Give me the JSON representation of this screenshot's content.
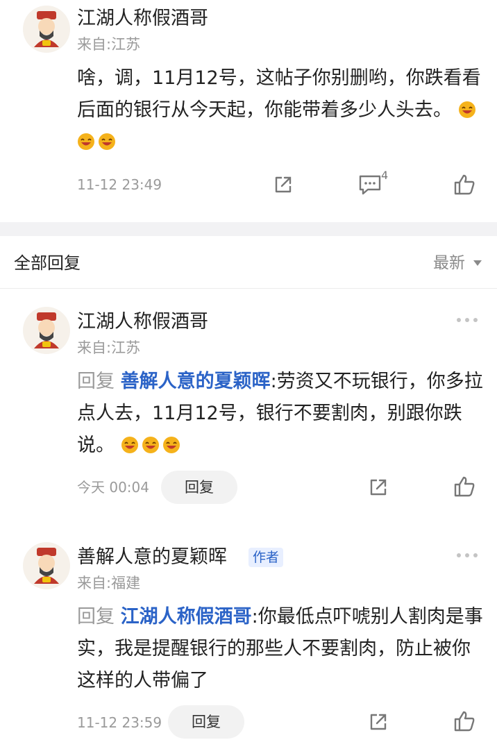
{
  "top_comment": {
    "username": "江湖人称假酒哥",
    "from": "来自:江苏",
    "text": "啥，调，11月12号，这帖子你别删哟，你跌看看后面的银行从今天起，你能带着多少人头去。",
    "time": "11-12 23:49",
    "comment_count": "4"
  },
  "replies_header": {
    "title": "全部回复",
    "sort_label": "最新"
  },
  "replies": [
    {
      "username": "江湖人称假酒哥",
      "from": "来自:江苏",
      "reply_prefix": "回复",
      "reply_to": "善解人意的夏颖晖",
      "text": ":劳资又不玩银行，你多拉点人去，11月12号，银行不要割肉，别跟你跌说。",
      "time": "今天 00:04",
      "reply_button": "回复"
    },
    {
      "username": "善解人意的夏颖晖",
      "author_tag": "作者",
      "from": "来自:福建",
      "reply_prefix": "回复",
      "reply_to": "江湖人称假酒哥",
      "text": ":你最低点吓唬别人割肉是事实，我是提醒银行的那些人不要割肉，防止被你这样的人带偏了",
      "time": "11-12 23:59",
      "reply_button": "回复"
    }
  ],
  "colors": {
    "link": "#2b63c7",
    "muted": "#9a9a9a",
    "divider_band": "#f2f2f4"
  }
}
